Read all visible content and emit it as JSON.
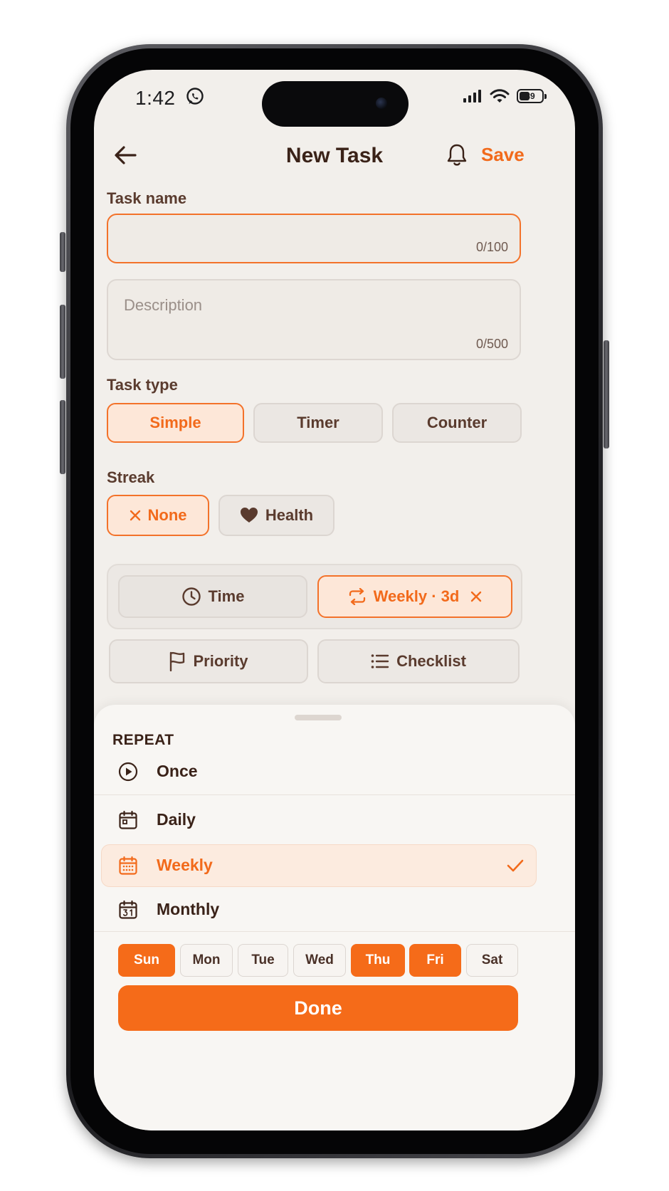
{
  "status_bar": {
    "time": "1:42",
    "battery": "39"
  },
  "header": {
    "title": "New Task",
    "save_label": "Save"
  },
  "task_name": {
    "label": "Task name",
    "value": "",
    "counter": "0/100"
  },
  "description": {
    "placeholder": "Description",
    "counter": "0/500"
  },
  "task_type": {
    "label": "Task type",
    "options": [
      "Simple",
      "Timer",
      "Counter"
    ],
    "selected": "Simple"
  },
  "streak": {
    "label": "Streak",
    "options": [
      "None",
      "Health"
    ],
    "selected": "None"
  },
  "options": {
    "time_label": "Time",
    "repeat_label": "Weekly · 3d",
    "priority_label": "Priority",
    "checklist_label": "Checklist"
  },
  "repeat_sheet": {
    "heading": "REPEAT",
    "items": [
      {
        "label": "Once",
        "icon": "play-circle-icon"
      },
      {
        "label": "Daily",
        "icon": "calendar-day-icon"
      },
      {
        "label": "Weekly",
        "icon": "calendar-week-icon"
      },
      {
        "label": "Monthly",
        "icon": "calendar-31-icon"
      }
    ],
    "selected": "Weekly",
    "days": [
      {
        "label": "Sun",
        "on": true
      },
      {
        "label": "Mon",
        "on": false
      },
      {
        "label": "Tue",
        "on": false
      },
      {
        "label": "Wed",
        "on": false
      },
      {
        "label": "Thu",
        "on": true
      },
      {
        "label": "Fri",
        "on": true
      },
      {
        "label": "Sat",
        "on": false
      }
    ],
    "done_label": "Done"
  },
  "colors": {
    "accent": "#f56b19",
    "accent_soft": "#fde7d8",
    "text": "#3a2218",
    "background": "#f2efeb"
  }
}
